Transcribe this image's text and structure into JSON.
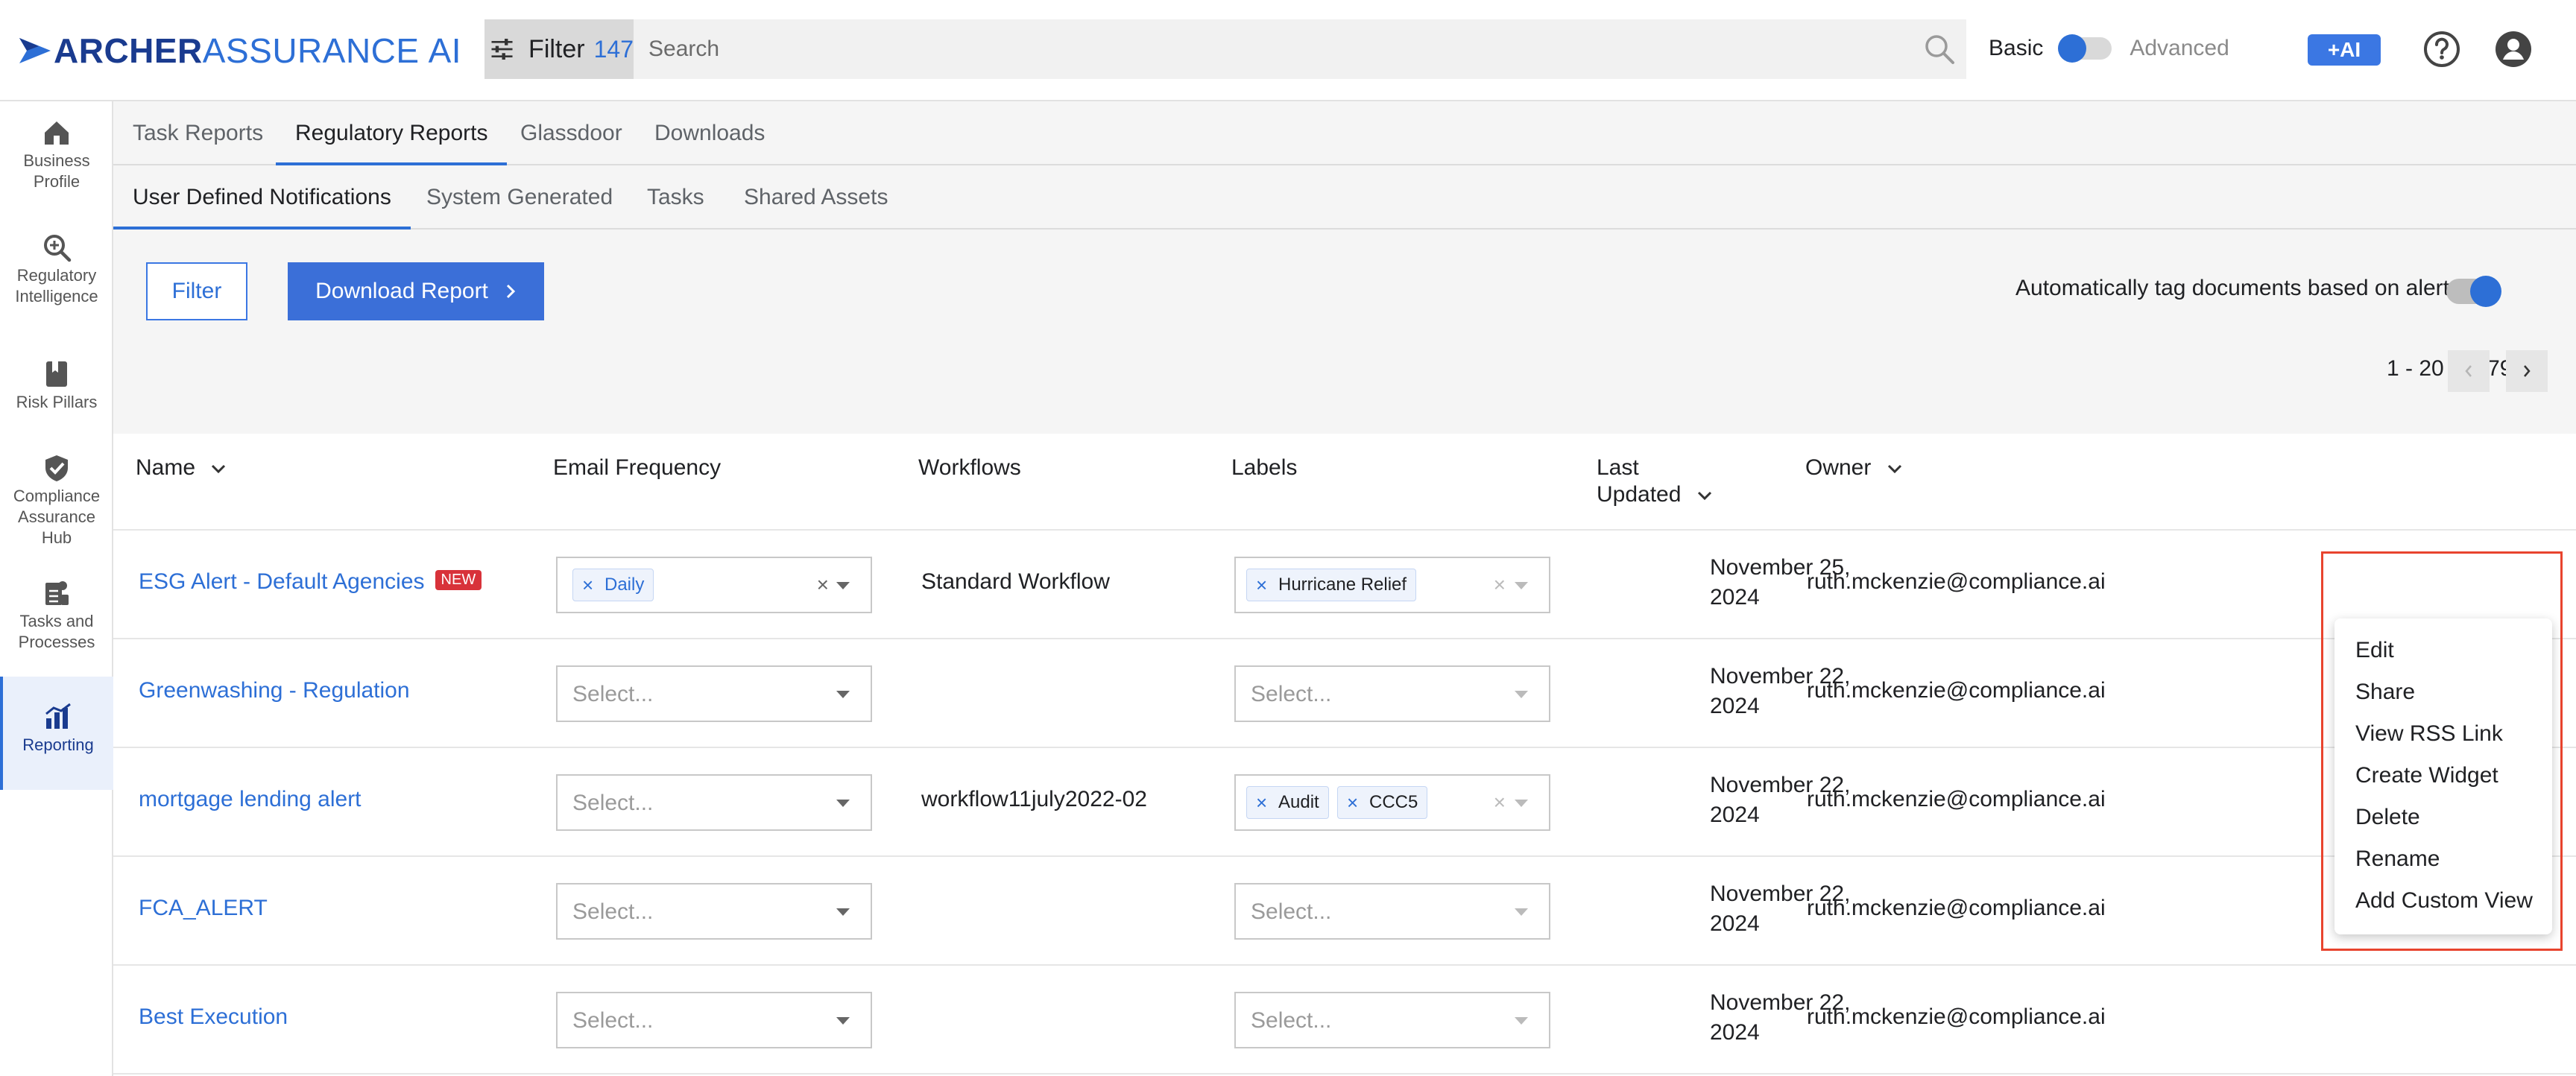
{
  "brand": {
    "logo_part1": "ARCHER",
    "logo_part2": "ASSURANCE",
    "logo_part3": "AI",
    "colors": {
      "primary": "#2d6fd6",
      "dark": "#1a3b8f",
      "badge": "#d8323a",
      "highlight": "#e8442e"
    }
  },
  "header": {
    "filter_label": "Filter",
    "filter_count": "147",
    "search_placeholder": "Search",
    "mode_basic": "Basic",
    "mode_advanced": "Advanced",
    "ai_button": "+AI",
    "icons": [
      "sliders-icon",
      "search-icon",
      "help-icon",
      "user-account-icon"
    ]
  },
  "sidebar": {
    "items": [
      {
        "label": "Business Profile",
        "icon": "house-icon"
      },
      {
        "label": "Regulatory Intelligence",
        "icon": "magnify-plus-icon"
      },
      {
        "label": "Risk Pillars",
        "icon": "bookmark-book-icon"
      },
      {
        "label": "Compliance Assurance Hub",
        "icon": "shield-check-icon"
      },
      {
        "label": "Tasks and Processes",
        "icon": "tasks-icon"
      },
      {
        "label": "Reporting",
        "icon": "bar-chart-icon",
        "active": true
      }
    ]
  },
  "tabs": {
    "primary": [
      "Task Reports",
      "Regulatory Reports",
      "Glassdoor",
      "Downloads"
    ],
    "primary_active": "Regulatory Reports",
    "secondary": [
      "User Defined Notifications",
      "System Generated",
      "Tasks",
      "Shared Assets"
    ],
    "secondary_active": "User Defined Notifications"
  },
  "toolbar": {
    "filter_button": "Filter",
    "download_button": "Download Report",
    "auto_tag_label": "Automatically tag documents based on alerts",
    "auto_tag_enabled": true,
    "pagination": "1 - 20 of 179"
  },
  "table": {
    "columns": {
      "name": "Name",
      "email_frequency": "Email Frequency",
      "workflows": "Workflows",
      "labels": "Labels",
      "last_updated_1": "Last",
      "last_updated_2": "Updated",
      "owner": "Owner"
    },
    "select_placeholder": "Select...",
    "rows": [
      {
        "name": "ESG Alert - Default Agencies",
        "badge": "NEW",
        "frequency": "Daily",
        "workflow": "Standard Workflow",
        "labels": [
          "Hurricane Relief"
        ],
        "date_1": "November 25,",
        "date_2": "2024",
        "owner": "ruth.mckenzie@compliance.ai"
      },
      {
        "name": "Greenwashing - Regulation",
        "badge": "",
        "frequency": "",
        "workflow": "",
        "labels": [],
        "date_1": "November 22,",
        "date_2": "2024",
        "owner": "ruth.mckenzie@compliance.ai"
      },
      {
        "name": "mortgage lending alert",
        "badge": "",
        "frequency": "",
        "workflow": "workflow11july2022-02",
        "labels": [
          "Audit",
          "CCC5"
        ],
        "date_1": "November 22,",
        "date_2": "2024",
        "owner": "ruth.mckenzie@compliance.ai"
      },
      {
        "name": "FCA_ALERT",
        "badge": "",
        "frequency": "",
        "workflow": "",
        "labels": [],
        "date_1": "November 22,",
        "date_2": "2024",
        "owner": "ruth.mckenzie@compliance.ai"
      },
      {
        "name": "Best Execution",
        "badge": "",
        "frequency": "",
        "workflow": "",
        "labels": [],
        "date_1": "November 22,",
        "date_2": "2024",
        "owner": "ruth.mckenzie@compliance.ai"
      }
    ]
  },
  "context_menu": {
    "items": [
      "Edit",
      "Share",
      "View RSS Link",
      "Create Widget",
      "Delete",
      "Rename",
      "Add Custom View"
    ]
  }
}
